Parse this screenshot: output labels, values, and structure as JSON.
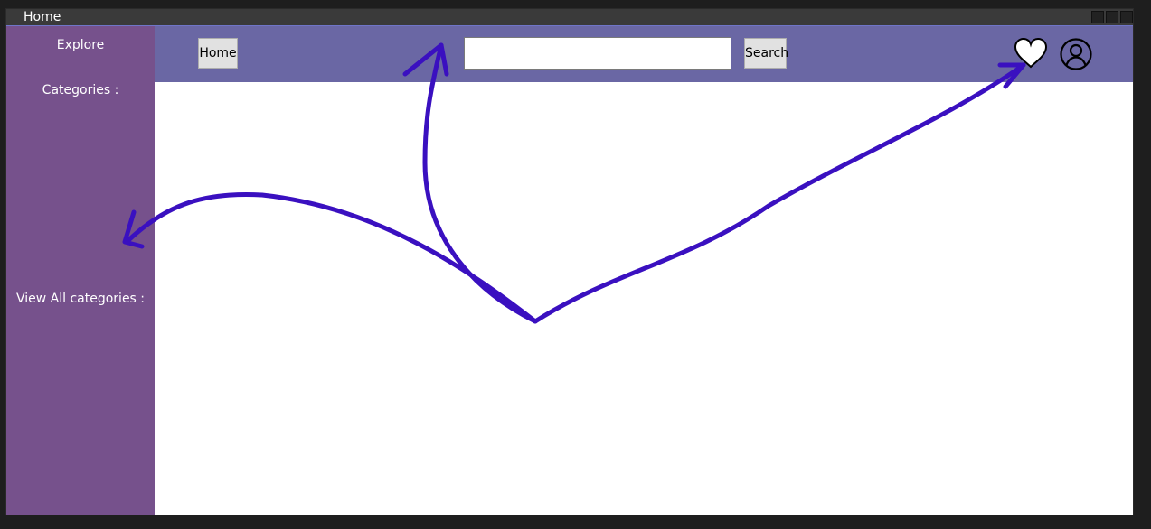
{
  "window": {
    "title": "Home"
  },
  "sidebar": {
    "explore_label": "Explore",
    "categories_label": "Categories :",
    "view_all_label": "View All categories :"
  },
  "header": {
    "home_label": "Home",
    "search_value": "",
    "search_label": "Search",
    "favorites_icon": "heart-icon",
    "account_icon": "user-icon"
  },
  "colors": {
    "sidebar": "#76518c",
    "header": "#6a67a4",
    "annotation": "#3a10c0",
    "titlebar": "#3a3a3a"
  }
}
